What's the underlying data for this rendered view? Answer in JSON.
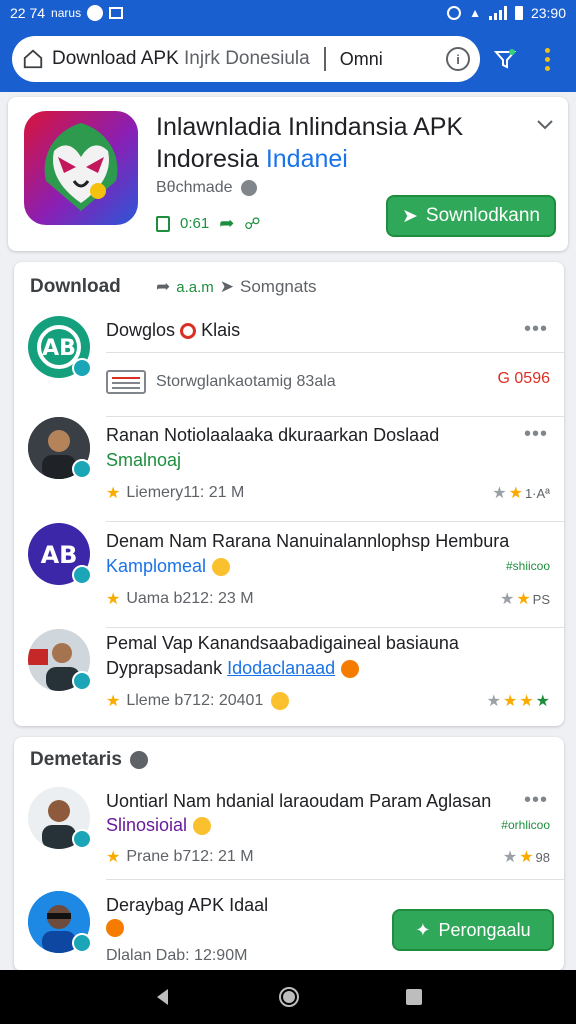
{
  "status": {
    "time": "22 74",
    "carrier": "narus",
    "clock": "23:90"
  },
  "browser": {
    "url_main": "Download APK ",
    "url_dim": "Injrk Donesiula",
    "omni": "Omni",
    "info": "i"
  },
  "app": {
    "title_line1": "Inlawnladia Inlindansia APK",
    "title_line2": "Indoresia",
    "title_blue": "Indanei",
    "developer": "Bθchmade",
    "stat_count": "0:61",
    "download_button": "Sownlodkann",
    "accent_green": "#2fa85a",
    "brand_blue": "#1a5fd0"
  },
  "download_section": {
    "heading": "Download",
    "tab_small": "a.a.m",
    "tab_label": "Somgnats",
    "rows": [
      {
        "title": "Dowglos",
        "title_tail": "Klais",
        "file_text": "Storwglankaotamig 83ala",
        "size": "G 0596"
      },
      {
        "title": "Ranan Notiolaalaaka dkuraarkan Doslaad",
        "subtitle": "Smalnoaj",
        "meta": "Liemery11:  21 M",
        "rating_tag": "1·Aª"
      },
      {
        "title": "Denam Nam Rarana Nanuinalannlophsp Hembura",
        "subtitle": "Kamplomeal",
        "meta": "Uama b212:  23 M",
        "tag": "#shiicoo",
        "rating_tag": "PS"
      },
      {
        "title": "Pemal Vap Kanandsaabadigaineal basiauna",
        "subtitle_prefix": "Dyprapsadank ",
        "subtitle": "Idodaclanaad",
        "meta": "Lleme b712:  20401",
        "rating_tag": ""
      }
    ]
  },
  "dem_section": {
    "heading": "Demetaris",
    "rows": [
      {
        "title": "Uontiarl Nam hdanial laraoudam Param Aglasan",
        "subtitle": "Slinosioial",
        "meta": "Prane b712:  21 M",
        "tag": "#orhlicoo",
        "rating_tag": "98"
      },
      {
        "title": "Deraybag APK Idaal",
        "meta": "Dlalan Dab:  12:90M",
        "button": "Perongaalu"
      }
    ]
  },
  "icons": [
    "home-icon",
    "info-icon",
    "filter-icon",
    "more-vert-icon",
    "back-icon",
    "home-circle-icon",
    "recents-icon"
  ]
}
